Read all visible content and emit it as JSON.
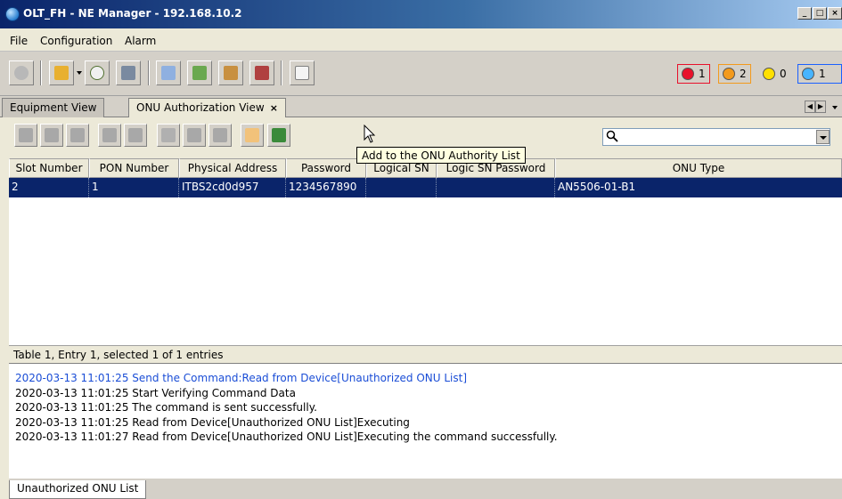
{
  "window": {
    "title": "OLT_FH - NE Manager - 192.168.10.2",
    "minimize": "_",
    "maximize": "□",
    "close": "×"
  },
  "menu": [
    "File",
    "Configuration",
    "Alarm"
  ],
  "alarms": [
    {
      "color": "#e8102a",
      "count": "1"
    },
    {
      "color": "#f39a1c",
      "count": "2"
    },
    {
      "color": "#ffe000",
      "count": "0"
    },
    {
      "color": "#46b4ff",
      "count": "1"
    }
  ],
  "tabs": [
    {
      "label": "Equipment View",
      "active": false
    },
    {
      "label": "ONU Authorization View",
      "active": true
    }
  ],
  "tooltip": "Add to the ONU Authority List",
  "table": {
    "columns": [
      "Slot Number",
      "PON Number",
      "Physical Address",
      "Password",
      "Logical SN",
      "Logic SN Password",
      "ONU Type"
    ],
    "rows": [
      [
        "2",
        "1",
        "ITBS2cd0d957",
        "1234567890",
        "",
        "",
        "AN5506-01-B1"
      ]
    ],
    "status": "Table 1, Entry 1, selected 1 of 1 entries"
  },
  "log": [
    "2020-03-13 11:01:25 Send the Command:Read from Device[Unauthorized ONU List]",
    "2020-03-13 11:01:25 Start Verifying Command Data",
    "2020-03-13 11:01:25 The command is sent successfully.",
    "2020-03-13 11:01:25 Read from Device[Unauthorized ONU List]Executing",
    "2020-03-13 11:01:27 Read from Device[Unauthorized ONU List]Executing the command successfully."
  ],
  "bottom_tab": "Unauthorized ONU List"
}
